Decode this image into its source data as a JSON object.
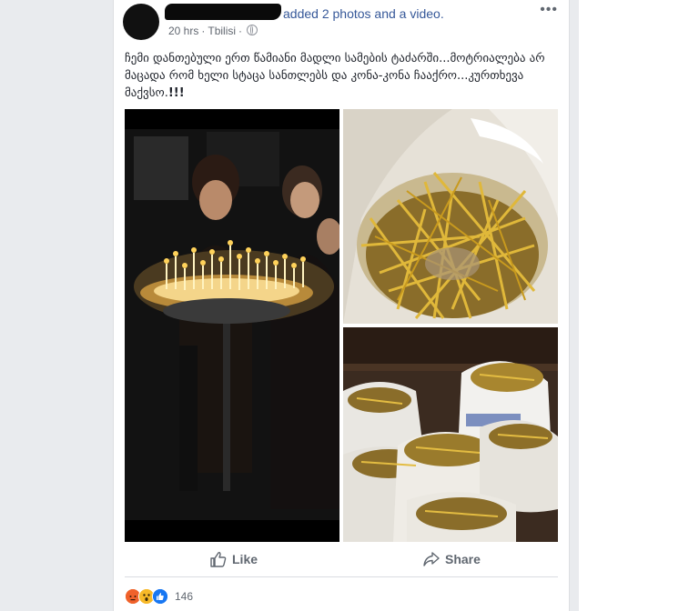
{
  "post": {
    "action_text": "added 2 photos and a video.",
    "action_prefix": "a",
    "time": "20 hrs",
    "location": "Tbilisi",
    "more_icon": "ellipsis-icon",
    "text": "ჩემი დანთებული ერთ წამიანი მადლი სამების ტაძარში...მოტრიალება არ მაცადა რომ ხელი სტაცა სანთლებს და კონა-კონა ჩააქრო...კურთხევა მაქვსო.",
    "text_emphasis": "!!!"
  },
  "actions": {
    "like_label": "Like",
    "share_label": "Share"
  },
  "reactions": {
    "icons": [
      "angry-reaction-icon",
      "wow-reaction-icon",
      "like-reaction-icon"
    ],
    "count": "146"
  },
  "colors": {
    "link": "#365899",
    "meta": "#616770",
    "action": "#606770",
    "like_blue": "#1877f2"
  }
}
